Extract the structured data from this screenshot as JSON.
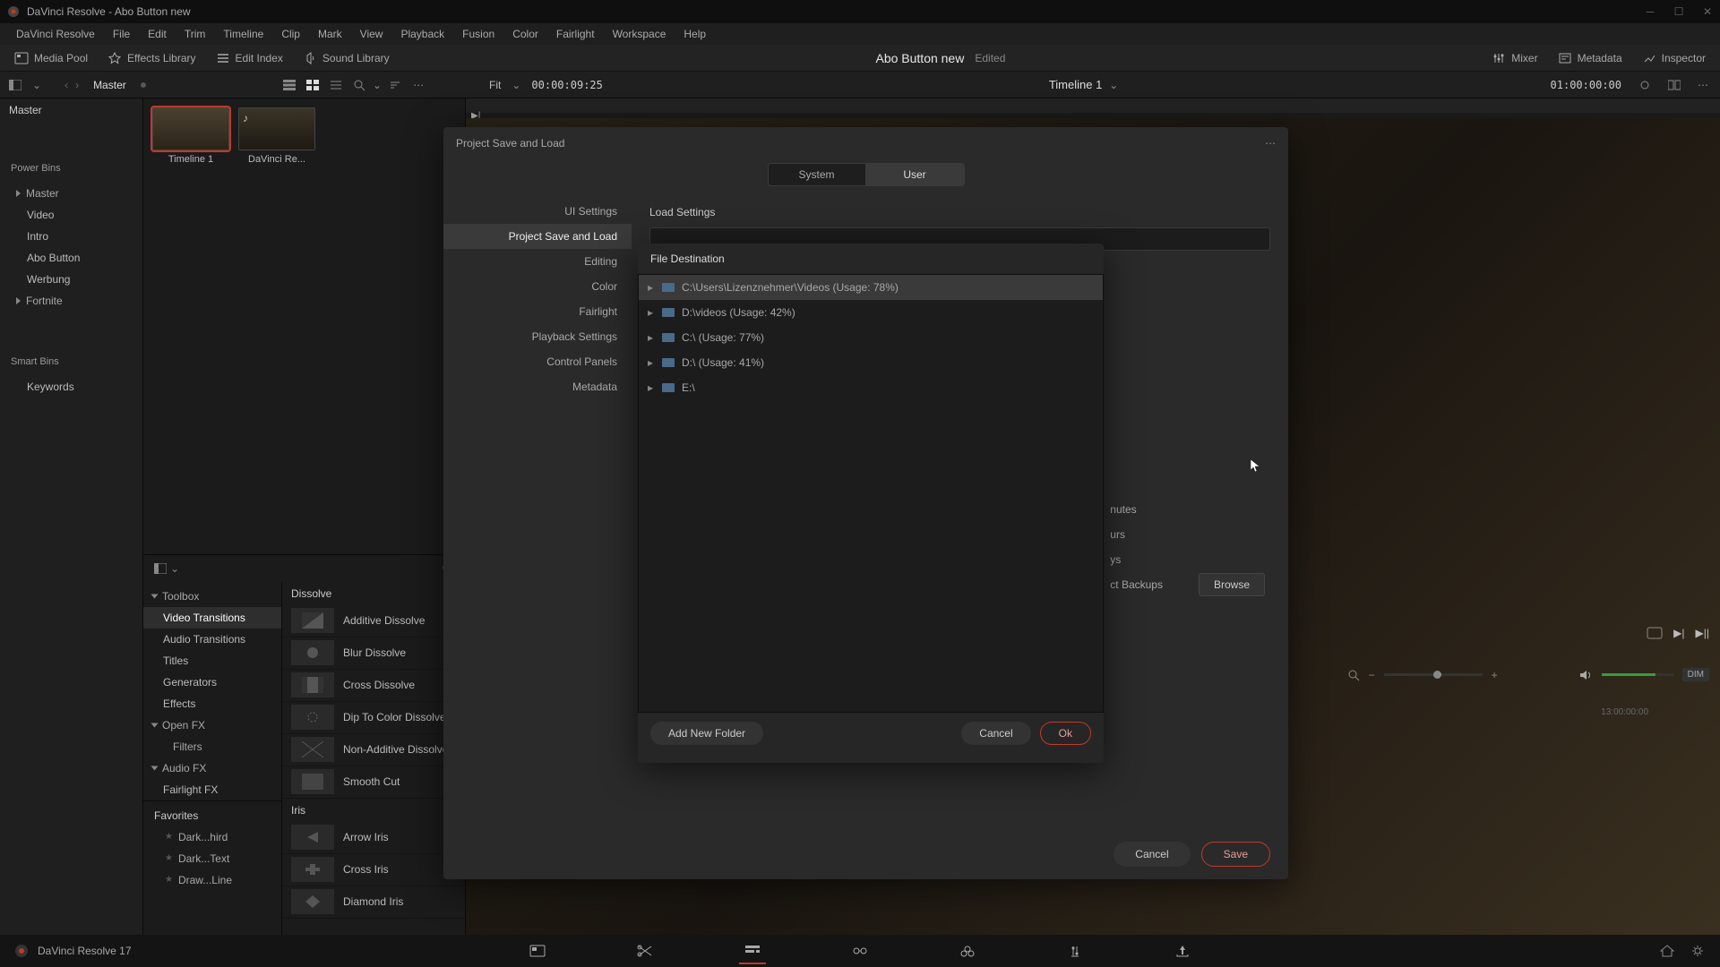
{
  "titlebar": {
    "text": "DaVinci Resolve - Abo Button new"
  },
  "menubar": [
    "DaVinci Resolve",
    "File",
    "Edit",
    "Trim",
    "Timeline",
    "Clip",
    "Mark",
    "View",
    "Playback",
    "Fusion",
    "Color",
    "Fairlight",
    "Workspace",
    "Help"
  ],
  "toolbar": {
    "media_pool": "Media Pool",
    "effects_library": "Effects Library",
    "edit_index": "Edit Index",
    "sound_library": "Sound Library",
    "project_name": "Abo Button new",
    "edited": "Edited",
    "mixer": "Mixer",
    "metadata": "Metadata",
    "inspector": "Inspector"
  },
  "sec": {
    "master": "Master",
    "fit": "Fit",
    "tc_left": "00:00:09:25",
    "timeline": "Timeline 1",
    "tc_right": "01:00:00:00"
  },
  "bins": {
    "master": "Master",
    "power": "Power Bins",
    "power_items": [
      "Master",
      "Video",
      "Intro",
      "Abo Button",
      "Werbung",
      "Fortnite"
    ],
    "smart": "Smart Bins",
    "smart_items": [
      "Keywords"
    ]
  },
  "thumbs": [
    {
      "label": "Timeline 1"
    },
    {
      "label": "DaVinci Re..."
    }
  ],
  "fx": {
    "toolbox": "Toolbox",
    "tree": [
      "Video Transitions",
      "Audio Transitions",
      "Titles",
      "Generators",
      "Effects"
    ],
    "openfx": "Open FX",
    "filters": "Filters",
    "audiofx": "Audio FX",
    "fairlightfx": "Fairlight FX",
    "favorites": "Favorites",
    "fav_items": [
      "Dark...hird",
      "Dark...Text",
      "Draw...Line"
    ],
    "cat_dissolve": "Dissolve",
    "dissolve_items": [
      "Additive Dissolve",
      "Blur Dissolve",
      "Cross Dissolve",
      "Dip To Color Dissolve",
      "Non-Additive Dissolve",
      "Smooth Cut"
    ],
    "cat_iris": "Iris",
    "iris_items": [
      "Arrow Iris",
      "Cross Iris",
      "Diamond Iris"
    ]
  },
  "settings": {
    "title": "Project Save and Load",
    "tab_system": "System",
    "tab_user": "User",
    "side": [
      "UI Settings",
      "Project Save and Load",
      "Editing",
      "Color",
      "Fairlight",
      "Playback Settings",
      "Control Panels",
      "Metadata"
    ],
    "load_settings": "Load Settings",
    "obscured": [
      "nutes",
      "urs",
      "ys",
      "ct Backups"
    ],
    "browse": "Browse",
    "cancel": "Cancel",
    "save": "Save"
  },
  "filedest": {
    "title": "File Destination",
    "rows": [
      "C:\\Users\\Lizenznehmer\\Videos (Usage: 78%)",
      "D:\\videos (Usage: 42%)",
      "C:\\ (Usage: 77%)",
      "D:\\ (Usage: 41%)",
      "E:\\"
    ],
    "add_folder": "Add New Folder",
    "cancel": "Cancel",
    "ok": "Ok"
  },
  "footer": {
    "version": "DaVinci Resolve 17"
  },
  "audio": {
    "dim": "DIM"
  },
  "timecode_ruler": "13:00:00:00"
}
